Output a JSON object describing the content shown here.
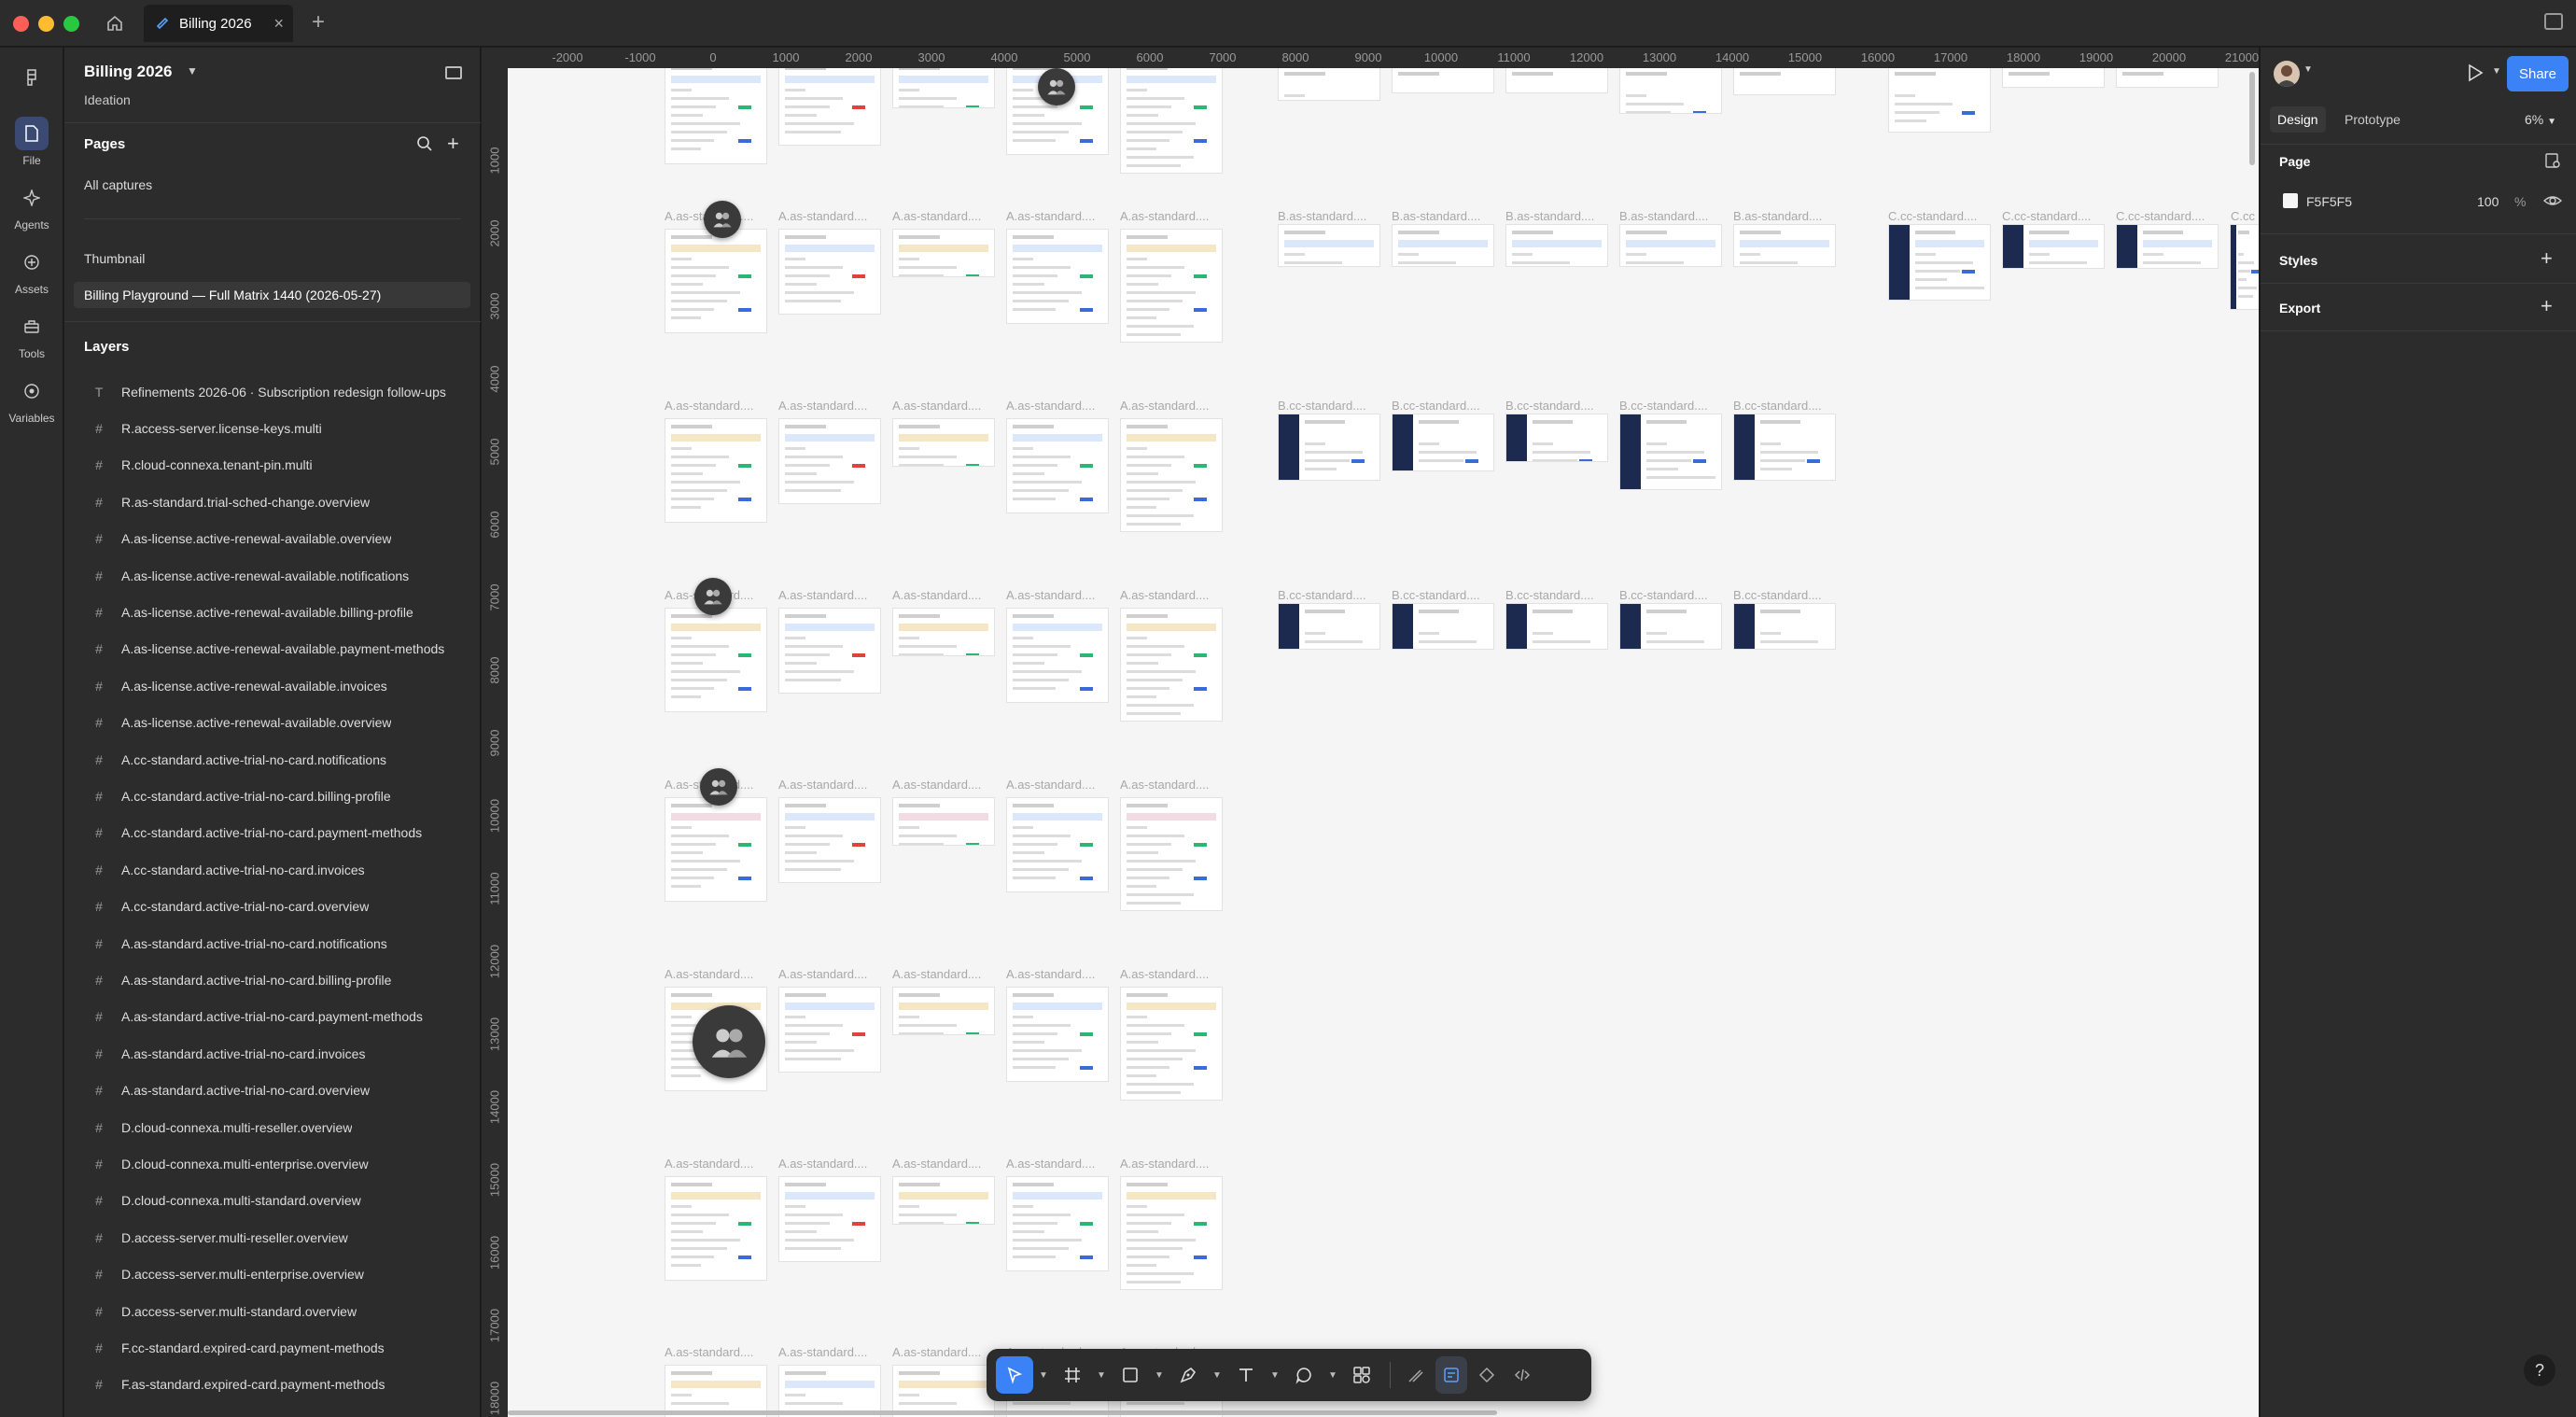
{
  "tabs": {
    "active_label": "Billing 2026"
  },
  "rail": [
    {
      "key": "file",
      "label": "File",
      "active": true
    },
    {
      "key": "agents",
      "label": "Agents"
    },
    {
      "key": "assets",
      "label": "Assets"
    },
    {
      "key": "tools",
      "label": "Tools"
    },
    {
      "key": "variables",
      "label": "Variables"
    }
  ],
  "file": {
    "name": "Billing 2026",
    "project": "Ideation"
  },
  "pages": {
    "title": "Pages",
    "items": [
      {
        "label": "All captures"
      },
      {
        "label": "Thumbnail"
      },
      {
        "label": "Billing Playground — Full Matrix 1440 (2026-05-27)",
        "active": true
      }
    ]
  },
  "layers": {
    "title": "Layers",
    "items": [
      {
        "label": "Refinements 2026-06 · Subscription redesign follow-ups",
        "icon": "text-icon"
      },
      {
        "label": "R.access-server.license-keys.multi",
        "icon": "frame-icon"
      },
      {
        "label": "R.cloud-connexa.tenant-pin.multi",
        "icon": "frame-icon"
      },
      {
        "label": "R.as-standard.trial-sched-change.overview",
        "icon": "frame-icon"
      },
      {
        "label": "A.as-license.active-renewal-available.overview",
        "icon": "frame-icon"
      },
      {
        "label": "A.as-license.active-renewal-available.notifications",
        "icon": "frame-icon"
      },
      {
        "label": "A.as-license.active-renewal-available.billing-profile",
        "icon": "frame-icon"
      },
      {
        "label": "A.as-license.active-renewal-available.payment-methods",
        "icon": "frame-icon"
      },
      {
        "label": "A.as-license.active-renewal-available.invoices",
        "icon": "frame-icon"
      },
      {
        "label": "A.as-license.active-renewal-available.overview",
        "icon": "frame-icon"
      },
      {
        "label": "A.cc-standard.active-trial-no-card.notifications",
        "icon": "frame-icon"
      },
      {
        "label": "A.cc-standard.active-trial-no-card.billing-profile",
        "icon": "frame-icon"
      },
      {
        "label": "A.cc-standard.active-trial-no-card.payment-methods",
        "icon": "frame-icon"
      },
      {
        "label": "A.cc-standard.active-trial-no-card.invoices",
        "icon": "frame-icon"
      },
      {
        "label": "A.cc-standard.active-trial-no-card.overview",
        "icon": "frame-icon"
      },
      {
        "label": "A.as-standard.active-trial-no-card.notifications",
        "icon": "frame-icon"
      },
      {
        "label": "A.as-standard.active-trial-no-card.billing-profile",
        "icon": "frame-icon"
      },
      {
        "label": "A.as-standard.active-trial-no-card.payment-methods",
        "icon": "frame-icon"
      },
      {
        "label": "A.as-standard.active-trial-no-card.invoices",
        "icon": "frame-icon"
      },
      {
        "label": "A.as-standard.active-trial-no-card.overview",
        "icon": "frame-icon"
      },
      {
        "label": "D.cloud-connexa.multi-reseller.overview",
        "icon": "frame-icon"
      },
      {
        "label": "D.cloud-connexa.multi-enterprise.overview",
        "icon": "frame-icon"
      },
      {
        "label": "D.cloud-connexa.multi-standard.overview",
        "icon": "frame-icon"
      },
      {
        "label": "D.access-server.multi-reseller.overview",
        "icon": "frame-icon"
      },
      {
        "label": "D.access-server.multi-enterprise.overview",
        "icon": "frame-icon"
      },
      {
        "label": "D.access-server.multi-standard.overview",
        "icon": "frame-icon"
      },
      {
        "label": "F.cc-standard.expired-card.payment-methods",
        "icon": "frame-icon"
      },
      {
        "label": "F.as-standard.expired-card.payment-methods",
        "icon": "frame-icon"
      }
    ]
  },
  "canvas": {
    "background": "#F5F5F5",
    "ruler_x": [
      "-2000",
      "-1000",
      "0",
      "1000",
      "2000",
      "3000",
      "4000",
      "5000",
      "6000",
      "7000",
      "8000",
      "9000",
      "10000",
      "11000",
      "12000",
      "13000",
      "14000",
      "15000",
      "16000",
      "17000",
      "18000",
      "19000",
      "20000",
      "21000"
    ],
    "ruler_y": [
      "1000",
      "2000",
      "3000",
      "4000",
      "5000",
      "6000",
      "7000",
      "8000",
      "9000",
      "10000",
      "11000",
      "12000",
      "13000",
      "14000",
      "15000",
      "16000",
      "17000",
      "18000"
    ],
    "frame_labels": {
      "a": "A.as-standard....",
      "b": "B.as-standard....",
      "bcc": "B.cc-standard....",
      "ccc": "C.cc-standard....",
      "ccc_short": "C.cc"
    }
  },
  "toolbar": {
    "tools": [
      "move-tool",
      "frame-tool",
      "rectangle-tool",
      "pen-tool",
      "text-tool",
      "comment-tool",
      "actions-tool"
    ],
    "right": [
      "draw-mode",
      "design-mode",
      "dev-components",
      "dev-mode"
    ]
  },
  "right_panel": {
    "share_label": "Share",
    "tabs": [
      "Design",
      "Prototype"
    ],
    "zoom": "6%",
    "page_section": "Page",
    "page_color": "F5F5F5",
    "page_opacity": "100",
    "page_opacity_unit": "%",
    "styles_section": "Styles",
    "export_section": "Export",
    "help": "?"
  },
  "colors": {
    "accent": "#3b82f6",
    "panel": "#2c2c2c",
    "canvas": "#f5f5f5",
    "dark_frame": "#1b2a4e"
  }
}
